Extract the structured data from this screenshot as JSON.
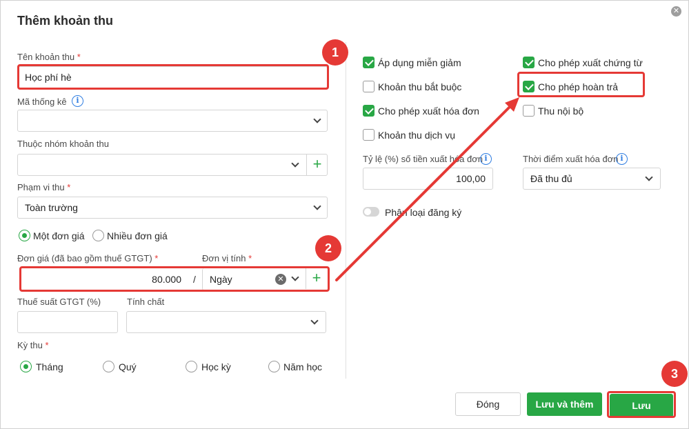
{
  "dialog": {
    "title": "Thêm khoản thu",
    "close_icon": "close-icon"
  },
  "left": {
    "ten_khoan_thu": {
      "label": "Tên khoản thu",
      "required": "*",
      "value": "Học phí hè"
    },
    "ma_thong_ke": {
      "label": "Mã thống kê",
      "value": ""
    },
    "nhom_khoan_thu": {
      "label": "Thuộc nhóm khoản thu",
      "value": ""
    },
    "pham_vi_thu": {
      "label": "Phạm vi thu",
      "required": "*",
      "value": "Toàn trường"
    },
    "don_gia_type": {
      "options": [
        "Một đơn giá",
        "Nhiều đơn giá"
      ],
      "selected": "Một đơn giá"
    },
    "don_gia": {
      "label": "Đơn giá (đã bao gồm thuế GTGT)",
      "required": "*",
      "value": "80.000",
      "separator": "/"
    },
    "don_vi_tinh": {
      "label": "Đơn vị tính",
      "required": "*",
      "value": "Ngày"
    },
    "thue_suat": {
      "label": "Thuế suất GTGT (%)",
      "value": ""
    },
    "tinh_chat": {
      "label": "Tính chất",
      "value": ""
    },
    "ky_thu": {
      "label": "Kỳ thu",
      "required": "*",
      "options": [
        "Tháng",
        "Quý",
        "Học kỳ",
        "Năm học"
      ],
      "selected": "Tháng"
    }
  },
  "right": {
    "checkboxes": [
      {
        "label": "Áp dụng miễn giảm",
        "checked": true
      },
      {
        "label": "Cho phép xuất chứng từ",
        "checked": true
      },
      {
        "label": "Khoản thu bắt buộc",
        "checked": false
      },
      {
        "label": "Cho phép hoàn trả",
        "checked": true
      },
      {
        "label": "Cho phép xuất hóa đơn",
        "checked": true
      },
      {
        "label": "Thu nội bộ",
        "checked": false
      },
      {
        "label": "Khoản thu dịch vụ",
        "checked": false
      }
    ],
    "ty_le": {
      "label": "Tỷ lệ (%) số tiền xuất hóa đơn",
      "value": "100,00"
    },
    "thoi_diem": {
      "label": "Thời điểm xuất hóa đơn",
      "value": "Đã thu đủ"
    },
    "phan_loai": {
      "label": "Phân loại đăng ký",
      "on": false
    }
  },
  "footer": {
    "dong": "Đóng",
    "luu_va_them": "Lưu và thêm",
    "luu": "Lưu"
  },
  "annotations": {
    "badges": [
      "1",
      "2",
      "3"
    ],
    "color": "#e53935"
  },
  "colors": {
    "accent": "#28a745",
    "info": "#2f7de1",
    "highlight": "#e53935"
  }
}
